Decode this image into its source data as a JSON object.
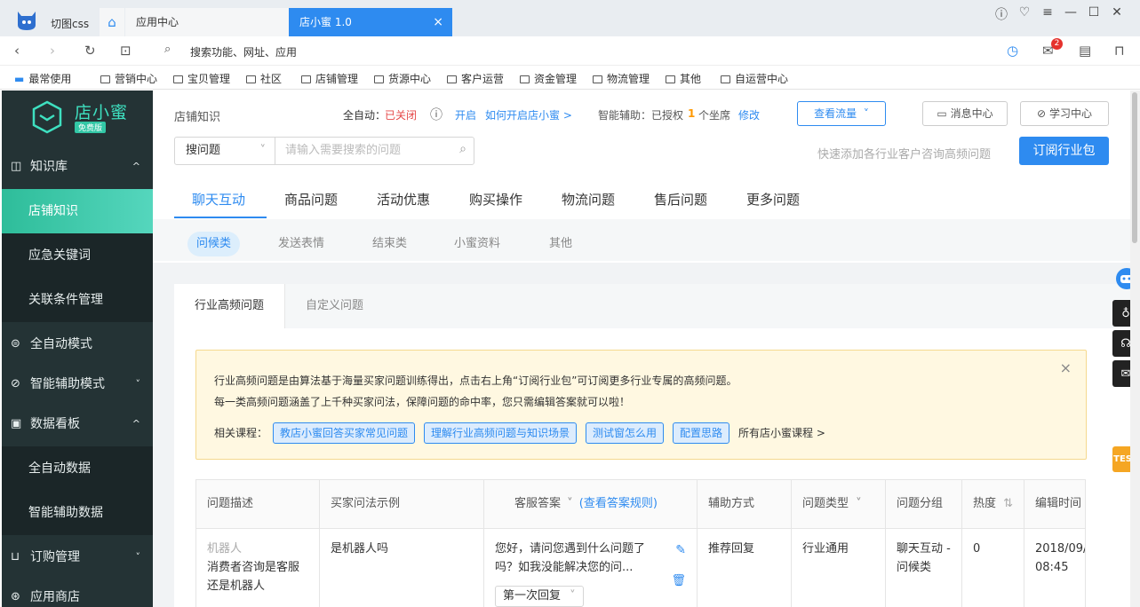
{
  "browser": {
    "app_name": "切图css",
    "tabs": [
      "应用中心",
      "店小蜜 1.0"
    ],
    "tab_close": "×",
    "address_placeholder": "搜索功能、网址、应用",
    "mail_count": "2",
    "bookmarks": [
      "最常使用",
      "营销中心",
      "宝贝管理",
      "社区",
      "店铺管理",
      "货源中心",
      "客户运营",
      "资金管理",
      "物流管理",
      "其他",
      "自运营中心"
    ]
  },
  "sidebar": {
    "brand": "店小蜜",
    "badge": "免费版",
    "items": [
      {
        "label": "知识库",
        "icon": "book-icon",
        "chevron": "^"
      },
      {
        "label": "店铺知识",
        "sub": true,
        "active": true
      },
      {
        "label": "应急关键词",
        "sub": true
      },
      {
        "label": "关联条件管理",
        "sub": true
      },
      {
        "label": "全自动模式",
        "icon": "auto-icon"
      },
      {
        "label": "智能辅助模式",
        "icon": "assist-icon",
        "chevron": "˅"
      },
      {
        "label": "数据看板",
        "icon": "dashboard-icon",
        "chevron": "^"
      },
      {
        "label": "全自动数据",
        "sub": true
      },
      {
        "label": "智能辅助数据",
        "sub": true
      },
      {
        "label": "订购管理",
        "icon": "cart-icon",
        "chevron": "˅"
      },
      {
        "label": "应用商店",
        "icon": "store-icon"
      }
    ]
  },
  "header": {
    "breadcrumb": "店铺知识",
    "auto_label": "全自动：",
    "auto_status": "已关闭",
    "enable": "开启",
    "how_to": "如何开启店小蜜 >",
    "assist_label": "智能辅助：已授权",
    "assist_count": "1",
    "assist_unit": "个坐席",
    "modify": "修改",
    "view_traffic": "查看流量",
    "message_center": "消息中心",
    "learning_center": "学习中心",
    "search_select": "搜问题",
    "search_placeholder": "请输入需要搜索的问题",
    "quick_add_hint": "快速添加各行业客户咨询高频问题",
    "subscribe": "订阅行业包"
  },
  "category_tabs": [
    "聊天互动",
    "商品问题",
    "活动优惠",
    "购买操作",
    "物流问题",
    "售后问题",
    "更多问题"
  ],
  "sub_tabs": [
    "问候类",
    "发送表情",
    "结束类",
    "小蜜资料",
    "其他"
  ],
  "panel": {
    "tabs": [
      "行业高频问题",
      "自定义问题"
    ],
    "notice_line1": "行业高频问题是由算法基于海量买家问题训练得出，点击右上角“订阅行业包”可订阅更多行业专属的高频问题。",
    "notice_line2": "每一类高频问题涵盖了上千种买家问法，保障问题的命中率，您只需编辑答案就可以啦！",
    "related_label": "相关课程：",
    "courses": [
      "教店小蜜回答买家常见问题",
      "理解行业高频问题与知识场景",
      "测试窗怎么用",
      "配置思路"
    ],
    "all_courses": "所有店小蜜课程 >",
    "close": "×"
  },
  "table": {
    "headers": [
      "问题描述",
      "买家问法示例",
      "客服答案",
      "(查看答案规则)",
      "辅助方式",
      "问题类型",
      "问题分组",
      "热度",
      "编辑时间"
    ],
    "row": {
      "desc_tag": "机器人",
      "desc": "消费者咨询是客服还是机器人",
      "example": "是机器人吗",
      "answer": "您好，请问您遇到什么问题了吗？如我没能解决您的问...",
      "answer_select": "第一次回复",
      "assist": "推荐回复",
      "type": "行业通用",
      "group": "聊天互动 - 问候类",
      "heat": "0",
      "date": "2018/09/",
      "time": "08:45"
    }
  },
  "floating": {
    "test": "TEST"
  }
}
